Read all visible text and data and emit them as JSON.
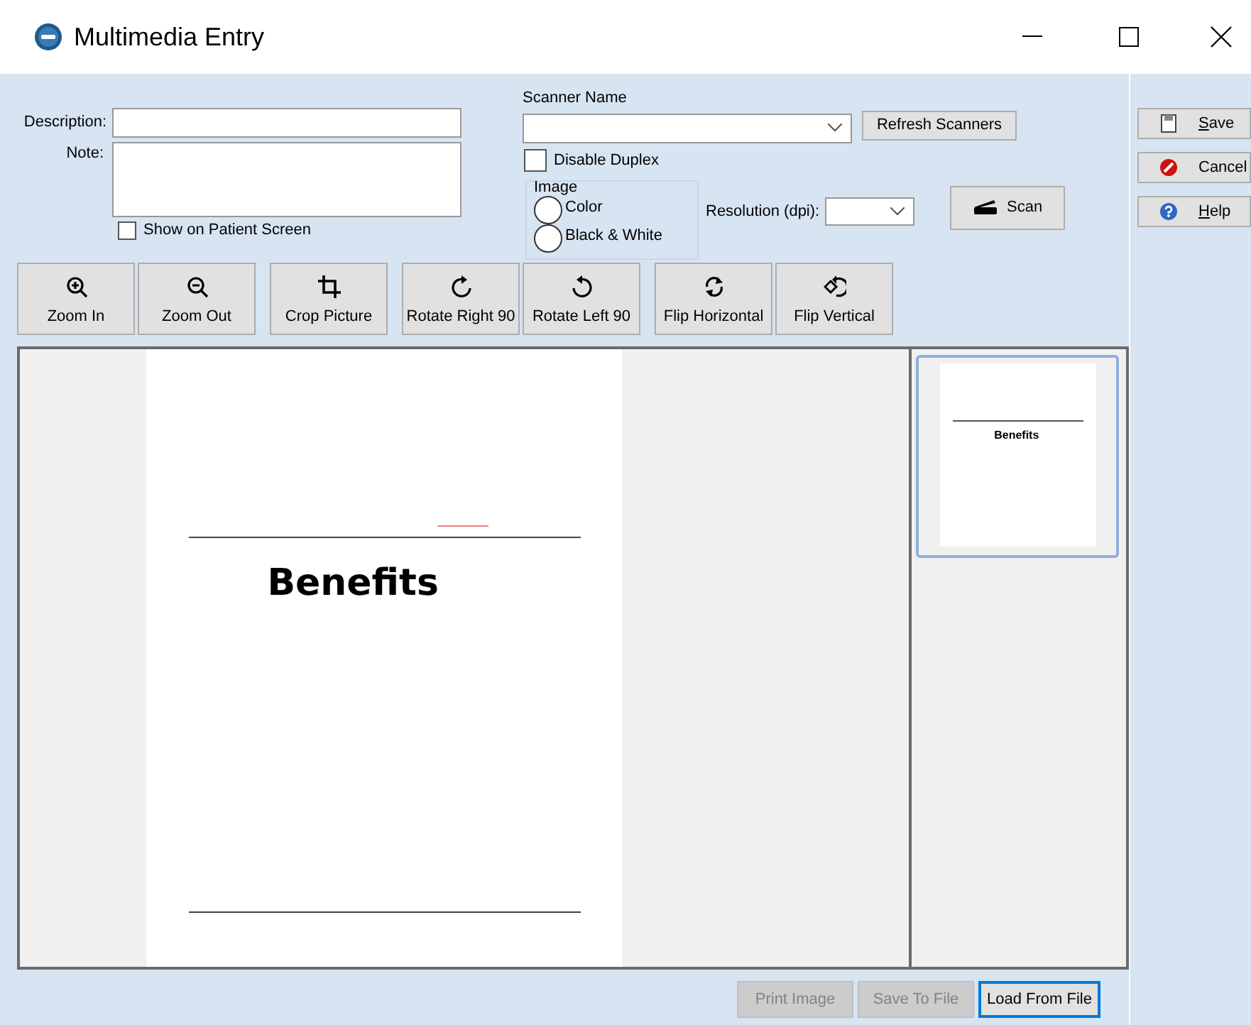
{
  "window": {
    "title": "Multimedia Entry"
  },
  "form": {
    "description_label": "Description:",
    "note_label": "Note:",
    "show_on_patient_screen": {
      "label": "Show on Patient Screen",
      "checked": false
    },
    "scanner_label": "Scanner Name",
    "refresh_button": "Refresh Scanners",
    "disable_duplex": {
      "label": "Disable Duplex",
      "checked": false
    },
    "image_group": {
      "title": "Image",
      "options": [
        {
          "label": "Color",
          "selected": false
        },
        {
          "label": "Black & White",
          "selected": false
        }
      ]
    },
    "resolution_label": "Resolution (dpi):",
    "scan_button": "Scan"
  },
  "toolbar": [
    {
      "label": "Zoom In",
      "kind": "zoom-in"
    },
    {
      "label": "Zoom Out",
      "kind": "zoom-out"
    },
    {
      "label": "Crop Picture",
      "kind": "crop"
    },
    {
      "label": "Rotate Right 90",
      "kind": "rotate-right"
    },
    {
      "label": "Rotate Left 90",
      "kind": "rotate-left"
    },
    {
      "label": "Flip Horizontal",
      "kind": "flip-h"
    },
    {
      "label": "Flip Vertical",
      "kind": "flip-v"
    }
  ],
  "document": {
    "heading": "Benefits"
  },
  "thumbnails": [
    {
      "heading": "Benefits",
      "selected": true
    }
  ],
  "bottom_buttons": [
    {
      "label": "Print Image",
      "disabled": true,
      "focused": false
    },
    {
      "label": "Save To File",
      "disabled": true,
      "focused": false
    },
    {
      "label": "Load From File",
      "disabled": false,
      "focused": true
    }
  ],
  "side_buttons": [
    {
      "label": "Save",
      "kind": "save",
      "underline_first": true
    },
    {
      "label": "Cancel",
      "kind": "cancel",
      "underline_first": false
    },
    {
      "label": "Help",
      "kind": "help",
      "underline_first": true
    }
  ]
}
